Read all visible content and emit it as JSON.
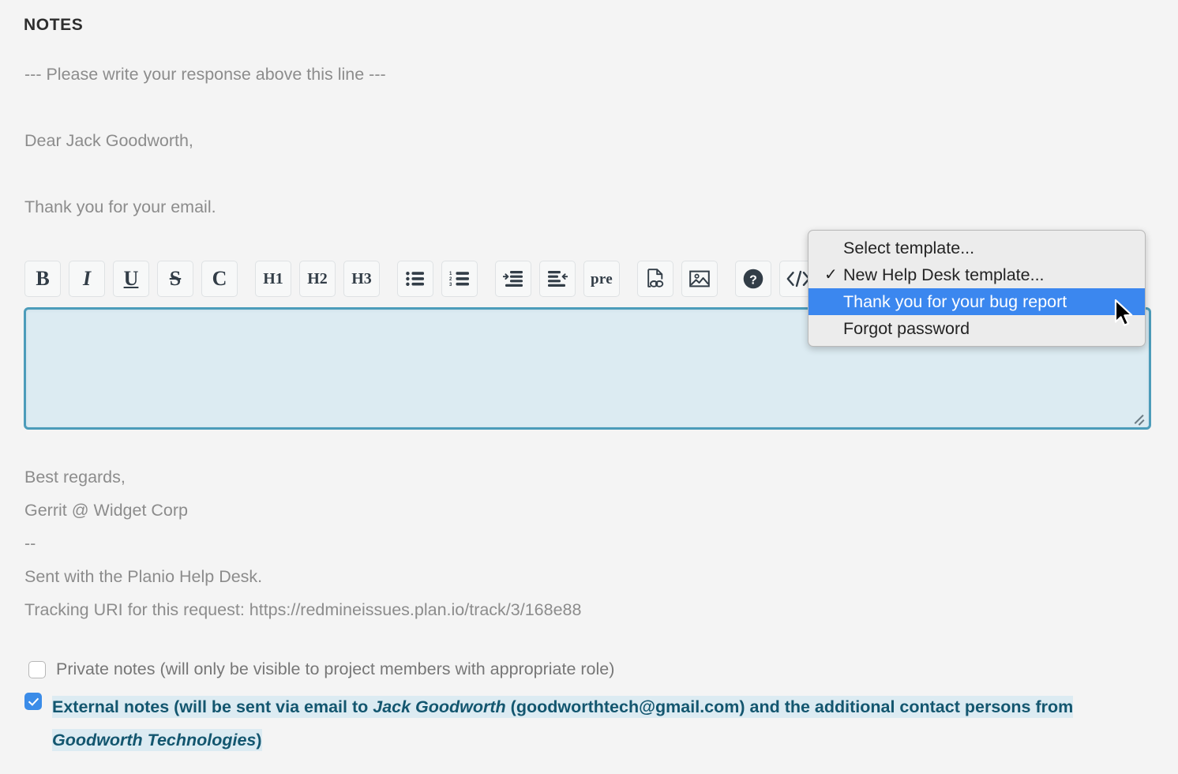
{
  "section": {
    "heading": "NOTES"
  },
  "message_body": {
    "lines": [
      "--- Please write your response above this line ---",
      "",
      "Dear Jack Goodworth,",
      "",
      "Thank you for your email."
    ],
    "line_1": "--- Please write your response above this line ---",
    "line_2": "Dear Jack Goodworth,",
    "line_3": "Thank you for your email."
  },
  "signature": {
    "line_1": "Best regards,",
    "line_2": "Gerrit @ Widget Corp",
    "line_3": "--",
    "line_4": "Sent with the Planio Help Desk.",
    "line_5": "Tracking URI for this request: https://redmineissues.plan.io/track/3/168e88"
  },
  "toolbar": {
    "buttons": [
      {
        "name": "bold-button",
        "label": "B",
        "title": "Bold"
      },
      {
        "name": "italic-button",
        "label": "I",
        "title": "Italic"
      },
      {
        "name": "underline-button",
        "label": "U",
        "title": "Underline"
      },
      {
        "name": "strikethrough-button",
        "label": "S",
        "title": "Strikethrough"
      },
      {
        "name": "code-inline-button",
        "label": "C",
        "title": "Inline code"
      },
      {
        "name": "heading-1-button",
        "label": "H1",
        "title": "Heading 1"
      },
      {
        "name": "heading-2-button",
        "label": "H2",
        "title": "Heading 2"
      },
      {
        "name": "heading-3-button",
        "label": "H3",
        "title": "Heading 3"
      },
      {
        "name": "unordered-list-button",
        "label": "",
        "title": "Unordered list"
      },
      {
        "name": "ordered-list-button",
        "label": "",
        "title": "Ordered list"
      },
      {
        "name": "indent-button",
        "label": "",
        "title": "Indent"
      },
      {
        "name": "outdent-button",
        "label": "",
        "title": "Outdent"
      },
      {
        "name": "preformatted-button",
        "label": "pre",
        "title": "Preformatted text"
      },
      {
        "name": "attach-link-button",
        "label": "",
        "title": "Link to file"
      },
      {
        "name": "insert-image-button",
        "label": "",
        "title": "Insert image"
      },
      {
        "name": "help-button",
        "label": "",
        "title": "Help"
      },
      {
        "name": "source-code-button",
        "label": "</>",
        "title": "Source code"
      }
    ],
    "labels": {
      "bold": "B",
      "italic": "I",
      "underline": "U",
      "strikethrough": "S",
      "inline_code": "C",
      "h1": "H1",
      "h2": "H2",
      "h3": "H3",
      "pre": "pre",
      "source": "</>"
    },
    "ordered_list_numbers": [
      "1",
      "2",
      "3"
    ]
  },
  "note_editor": {
    "value": "",
    "placeholder": ""
  },
  "template_menu": {
    "items": [
      {
        "label": "Select template...",
        "checked": false,
        "selected": false
      },
      {
        "label": "New Help Desk template...",
        "checked": true,
        "selected": false
      },
      {
        "label": "Thank you for your bug report",
        "checked": false,
        "selected": true
      },
      {
        "label": "Forgot password",
        "checked": false,
        "selected": false
      }
    ],
    "check_glyph": "✓"
  },
  "options": {
    "private_notes_label": "Private notes (will only be visible to project members with appropriate role)",
    "private_notes_checked": false,
    "external_notes_checked": true,
    "external_notes": {
      "part_1": "External notes (will be sent via email to ",
      "recipient_name": "Jack Goodworth",
      "part_2": " (goodworthtech@gmail.com) and the additional contact persons from ",
      "organization": "Goodworth Technologies",
      "part_3": ")"
    }
  },
  "colors": {
    "page_background": "#f4f4f4",
    "editor_border": "#4c9cba",
    "editor_fill": "#dcebf2",
    "menu_highlight": "#3b87ef",
    "checkbox_checked": "#3b8ce8",
    "external_text": "#13566f",
    "body_text": "#8c8c8c"
  }
}
